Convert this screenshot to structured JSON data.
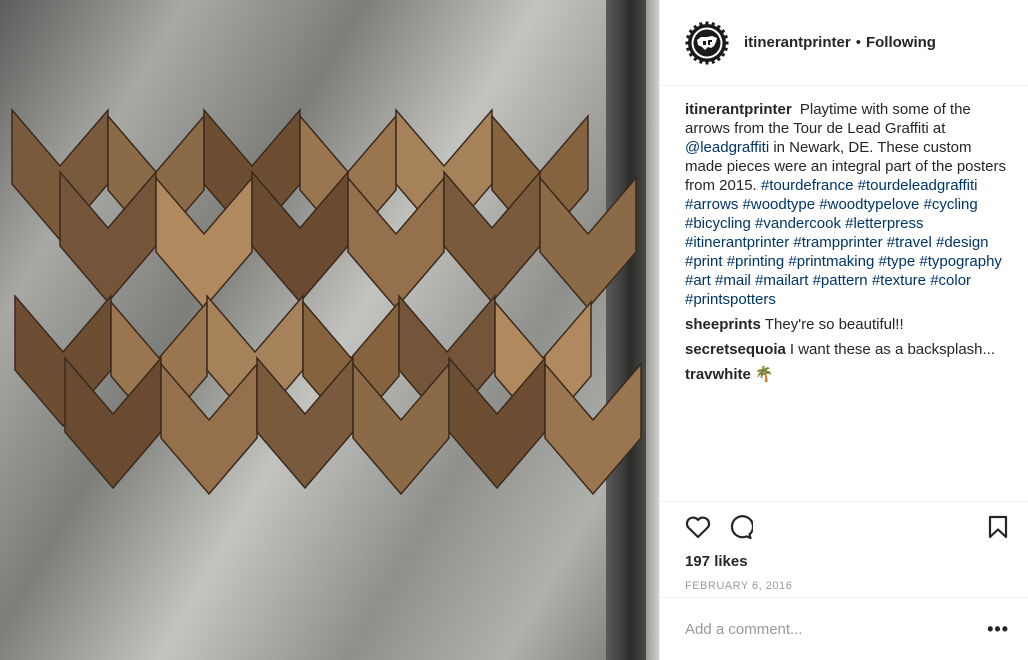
{
  "header": {
    "username": "itinerantprinter",
    "separator": "•",
    "follow_status": "Following",
    "avatar_icon": "usa-gear-logo-icon"
  },
  "comments": {
    "caption": {
      "author": "itinerantprinter",
      "text_1": "Playtime with some of the arrows from the Tour de Lead Graffiti at",
      "mention": "@leadgraffiti",
      "text_2": "in Newark, DE. These custom made pieces were an integral part of the posters from 2015.",
      "hashtags": [
        "#tourdefrance",
        "#tourdeleadgraffiti",
        "#arrows",
        "#woodtype",
        "#woodtypelove",
        "#cycling",
        "#bicycling",
        "#vandercook",
        "#letterpress",
        "#itinerantprinter",
        "#trampprinter",
        "#travel",
        "#design",
        "#print",
        "#printing",
        "#printmaking",
        "#type",
        "#typography",
        "#art",
        "#mail",
        "#mailart",
        "#pattern",
        "#texture",
        "#color",
        "#printspotters"
      ]
    },
    "list": [
      {
        "author": "sheeprints",
        "text": "They're so beautiful!!"
      },
      {
        "author": "secretsequoia",
        "text": "I want these as a backsplash..."
      },
      {
        "author": "travwhite",
        "text": "🌴"
      }
    ]
  },
  "actions": {
    "like_icon": "heart-icon",
    "comment_icon": "comment-bubble-icon",
    "save_icon": "bookmark-icon",
    "likes": "197 likes",
    "date": "FEBRUARY 6, 2016"
  },
  "add_comment": {
    "placeholder": "Add a comment...",
    "more_label": "•••"
  },
  "colors": {
    "text": "#262626",
    "hashtag": "#003569",
    "muted": "#999999",
    "divider": "#efefef"
  }
}
